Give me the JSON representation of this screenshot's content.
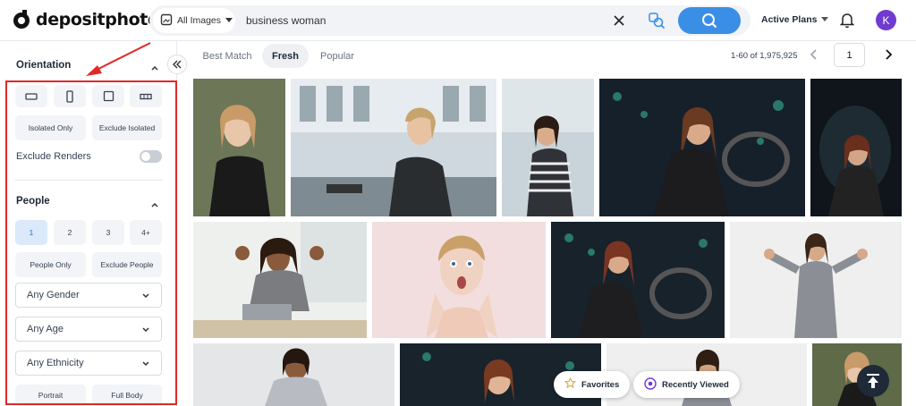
{
  "header": {
    "logo_text": "depositphotos",
    "search_scope": "All Images",
    "search_query": "business woman",
    "plans_label": "Active Plans",
    "avatar_initial": "K",
    "accent_color": "#3b8ee6"
  },
  "sidebar": {
    "orientation_title": "Orientation",
    "isolated_only": "Isolated Only",
    "exclude_isolated": "Exclude Isolated",
    "exclude_renders": "Exclude Renders",
    "people_title": "People",
    "people_counts": [
      "1",
      "2",
      "3",
      "4+"
    ],
    "people_only": "People Only",
    "exclude_people": "Exclude People",
    "gender": "Any Gender",
    "age": "Any Age",
    "ethnicity": "Any Ethnicity",
    "portrait": "Portrait",
    "full_body": "Full Body",
    "highlight_color": "#e32727"
  },
  "results": {
    "tabs": [
      "Best Match",
      "Fresh",
      "Popular"
    ],
    "active_tab": "Fresh",
    "count": "1-60 of 1,975,925",
    "page": "1"
  },
  "floating": {
    "favorites": "Favorites",
    "recently_viewed": "Recently Viewed"
  }
}
